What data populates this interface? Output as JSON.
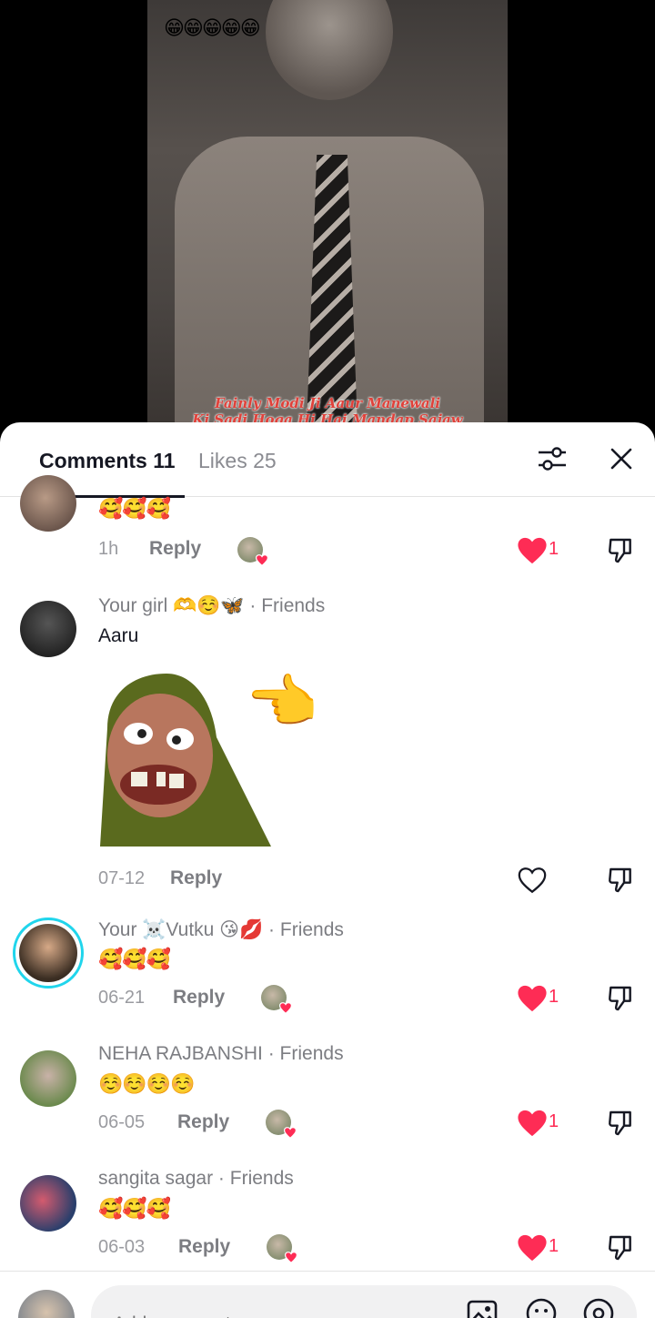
{
  "video": {
    "top_emojis": "😁😁😁😁😁",
    "caption_line1": "Fainly Modi Ji Aaur Manewali",
    "caption_line2": "Ki Sadi Hoga Hi Hai Mandap Sajaw"
  },
  "header": {
    "comments_tab": "Comments 11",
    "likes_tab": "Likes 25",
    "filter_icon": "sliders-icon",
    "close_icon": "close-icon"
  },
  "comments": [
    {
      "text": "🥰🥰🥰",
      "date": "1h",
      "reply": "Reply",
      "like_count": "1",
      "liked": true
    },
    {
      "username": "Your girl 🫶☺️🦋 · Friends",
      "text": "Aaru",
      "date": "07-12",
      "reply": "Reply",
      "liked": false
    },
    {
      "username": "Your ☠️Vutku 😘💋 · Friends",
      "text": "🥰🥰🥰",
      "date": "06-21",
      "reply": "Reply",
      "like_count": "1",
      "liked": true
    },
    {
      "username": "NEHA RAJBANSHI · Friends",
      "text": "☺️☺️☺️☺️",
      "date": "06-05",
      "reply": "Reply",
      "like_count": "1",
      "liked": true
    },
    {
      "username": "sangita sagar · Friends",
      "text": "🥰🥰🥰",
      "date": "06-03",
      "reply": "Reply",
      "like_count": "1",
      "liked": true
    }
  ],
  "input": {
    "placeholder": "Add comment..."
  },
  "colors": {
    "like_red": "#fe2c55",
    "story_ring": "#20d5ec",
    "text_primary": "#161823",
    "text_secondary": "#7c7d82"
  }
}
